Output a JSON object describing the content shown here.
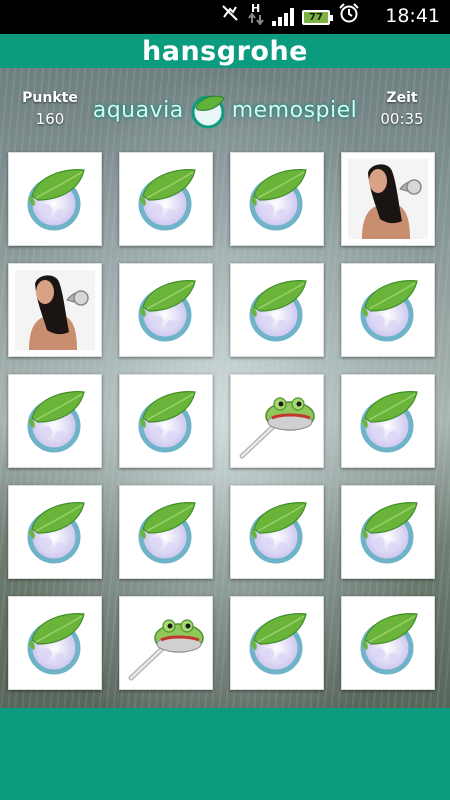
{
  "status_bar": {
    "time": "18:41",
    "battery_level": "77",
    "icons": [
      "mute-icon",
      "data-transfer-icon",
      "signal-icon",
      "battery-icon",
      "alarm-icon"
    ]
  },
  "header": {
    "brand": "hansgrohe"
  },
  "hud": {
    "score_label": "Punkte",
    "score_value": "160",
    "time_label": "Zeit",
    "time_value": "00:35"
  },
  "logo": {
    "left_word": "aquavia",
    "right_word": "memospiel"
  },
  "colors": {
    "brand_green": "#0b9c80",
    "leaf_green": "#6bb43a",
    "ring_blue": "#6fb3c9"
  },
  "board": {
    "rows": 5,
    "columns": 4,
    "cards": [
      {
        "face": "back"
      },
      {
        "face": "back"
      },
      {
        "face": "back"
      },
      {
        "face": "woman-shower"
      },
      {
        "face": "woman-shower"
      },
      {
        "face": "back"
      },
      {
        "face": "back"
      },
      {
        "face": "back"
      },
      {
        "face": "back"
      },
      {
        "face": "back"
      },
      {
        "face": "frog-shower"
      },
      {
        "face": "back"
      },
      {
        "face": "back"
      },
      {
        "face": "back"
      },
      {
        "face": "back"
      },
      {
        "face": "back"
      },
      {
        "face": "back"
      },
      {
        "face": "frog-shower"
      },
      {
        "face": "back"
      },
      {
        "face": "back"
      }
    ]
  }
}
